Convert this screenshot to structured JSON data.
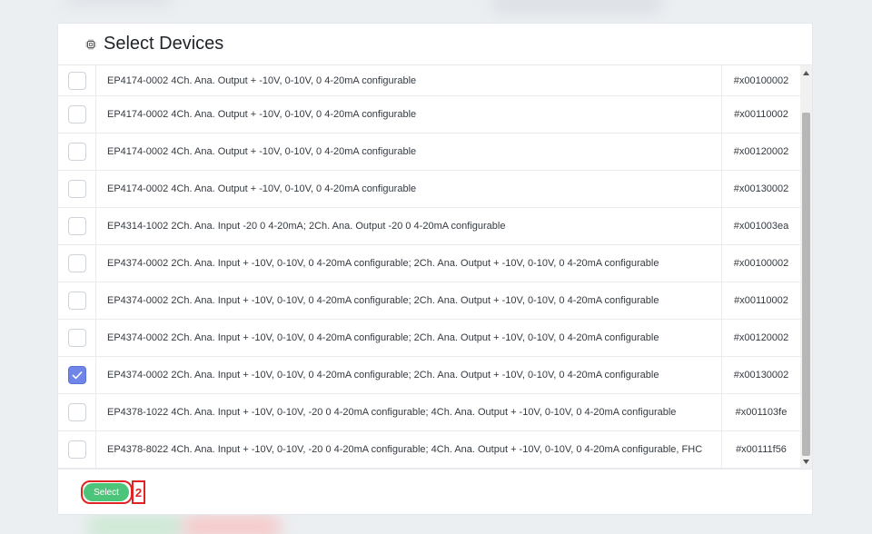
{
  "modal": {
    "title": "Select Devices",
    "title_icon": "chip-icon"
  },
  "devices": [
    {
      "description": "EP4174-0002 4Ch. Ana. Output + -10V, 0-10V, 0 4-20mA configurable",
      "address": "#x00100002",
      "checked": false
    },
    {
      "description": "EP4174-0002 4Ch. Ana. Output + -10V, 0-10V, 0 4-20mA configurable",
      "address": "#x00110002",
      "checked": false
    },
    {
      "description": "EP4174-0002 4Ch. Ana. Output + -10V, 0-10V, 0 4-20mA configurable",
      "address": "#x00120002",
      "checked": false
    },
    {
      "description": "EP4174-0002 4Ch. Ana. Output + -10V, 0-10V, 0 4-20mA configurable",
      "address": "#x00130002",
      "checked": false
    },
    {
      "description": "EP4314-1002 2Ch. Ana. Input -20 0 4-20mA; 2Ch. Ana. Output -20 0 4-20mA configurable",
      "address": "#x001003ea",
      "checked": false
    },
    {
      "description": "EP4374-0002 2Ch. Ana. Input + -10V, 0-10V, 0 4-20mA configurable; 2Ch. Ana. Output + -10V, 0-10V, 0 4-20mA configurable",
      "address": "#x00100002",
      "checked": false
    },
    {
      "description": "EP4374-0002 2Ch. Ana. Input + -10V, 0-10V, 0 4-20mA configurable; 2Ch. Ana. Output + -10V, 0-10V, 0 4-20mA configurable",
      "address": "#x00110002",
      "checked": false
    },
    {
      "description": "EP4374-0002 2Ch. Ana. Input + -10V, 0-10V, 0 4-20mA configurable; 2Ch. Ana. Output + -10V, 0-10V, 0 4-20mA configurable",
      "address": "#x00120002",
      "checked": false
    },
    {
      "description": "EP4374-0002 2Ch. Ana. Input + -10V, 0-10V, 0 4-20mA configurable; 2Ch. Ana. Output + -10V, 0-10V, 0 4-20mA configurable",
      "address": "#x00130002",
      "checked": true
    },
    {
      "description": "EP4378-1022 4Ch. Ana. Input + -10V, 0-10V, -20 0 4-20mA configurable; 4Ch. Ana. Output + -10V, 0-10V, 0 4-20mA configurable",
      "address": "#x001103fe",
      "checked": false
    },
    {
      "description": "EP4378-8022 4Ch. Ana. Input + -10V, 0-10V, -20 0 4-20mA configurable; 4Ch. Ana. Output + -10V, 0-10V, 0 4-20mA configurable, FHC",
      "address": "#x00111f56",
      "checked": false
    }
  ],
  "footer": {
    "select_label": "Select",
    "marker_label": "2"
  },
  "colors": {
    "select_button": "#4cc47a",
    "checkbox_checked": "#6f86e8",
    "highlight": "#e02424"
  }
}
